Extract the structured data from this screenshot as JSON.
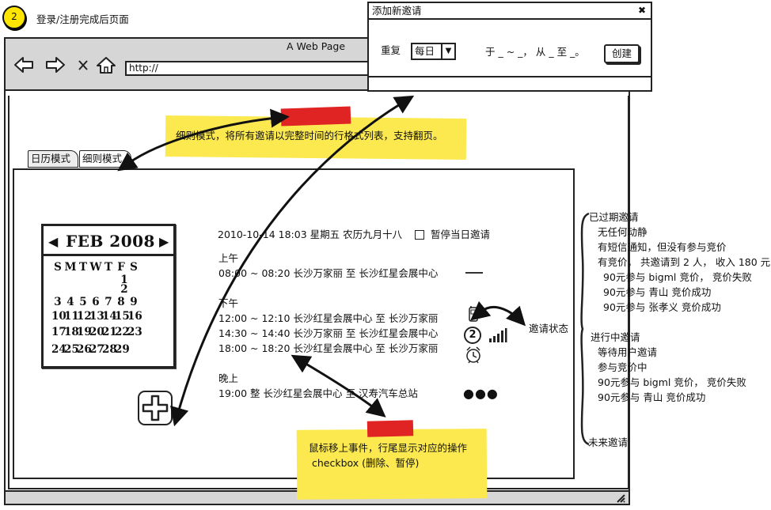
{
  "step_number": "2",
  "page_caption": "登录/注册完成后页面",
  "browser": {
    "title": "A Web Page",
    "url": "http://"
  },
  "tabs": [
    {
      "label": "日历模式"
    },
    {
      "label": "细则模式"
    }
  ],
  "annotations": {
    "detail_mode_note": "细则模式，将所有邀请以完整时间的行格式列表，支持翻页。",
    "hover_note_line1": "鼠标移上事件，行尾显示对应的操作",
    "hover_note_line2": "checkbox (删除、暂停)",
    "status_label": "邀请状态"
  },
  "popup": {
    "title": "添加新邀请",
    "repeat_label": "重复",
    "repeat_value": "每日",
    "time_pattern": "于 _ ~ _， 从 _ 至 _。",
    "create_button": "创建"
  },
  "calendar": {
    "month_label": "FEB 2008",
    "weekdays": [
      "S",
      "M",
      "T",
      "W",
      "T",
      "F",
      "S"
    ],
    "weeks": [
      [
        "",
        "",
        "",
        "",
        "",
        "1",
        ""
      ],
      [
        "",
        "",
        "",
        "",
        "",
        "",
        "2"
      ],
      [
        "3",
        "4",
        "5",
        "6",
        "7",
        "8",
        "9"
      ],
      [
        "10",
        "11",
        "12",
        "13",
        "14",
        "15",
        "16"
      ],
      [
        "17",
        "18",
        "19",
        "20",
        "21",
        "22",
        "23"
      ],
      [
        "24",
        "25",
        "26",
        "27",
        "28",
        "29",
        ""
      ]
    ]
  },
  "schedule": {
    "date_line": "2010-10-14 18:03 星期五 农历九月十八",
    "pause_today_label": "暂停当日邀请",
    "sections": [
      {
        "title": "上午",
        "items": [
          "08:00 ~ 08:20 长沙万家丽 至 长沙红星会展中心"
        ]
      },
      {
        "title": "下午",
        "items": [
          "12:00 ~ 12:10 长沙红星会展中心 至 长沙万家丽",
          "14:30 ~ 14:40 长沙万家丽 至 长沙红星会展中心",
          "18:00 ~ 18:20 长沙红星会展中心 至 长沙万家丽"
        ]
      },
      {
        "title": "晚上",
        "items": [
          "19:00 整 长沙红星会展中心 至 汉寿汽车总站"
        ]
      }
    ],
    "status_icon_number": "2"
  },
  "status_panel": {
    "expired": {
      "title": "已过期邀请",
      "lines": [
        "无任何动静",
        "有短信通知，但没有参与竞价",
        "有竞价， 共邀请到 2 人， 收入 180 元",
        "90元参与 bigml 竞价， 竞价失败",
        "90元参与 青山 竞价成功",
        "90元参与 张孝义 竞价成功"
      ]
    },
    "ongoing": {
      "title": "进行中邀请",
      "lines": [
        "等待用户邀请",
        "参与竞价中",
        "90元参与 bigml 竞价， 竞价失败",
        "90元参与 青山 竞价成功"
      ]
    },
    "future": {
      "title": "未来邀请"
    }
  }
}
